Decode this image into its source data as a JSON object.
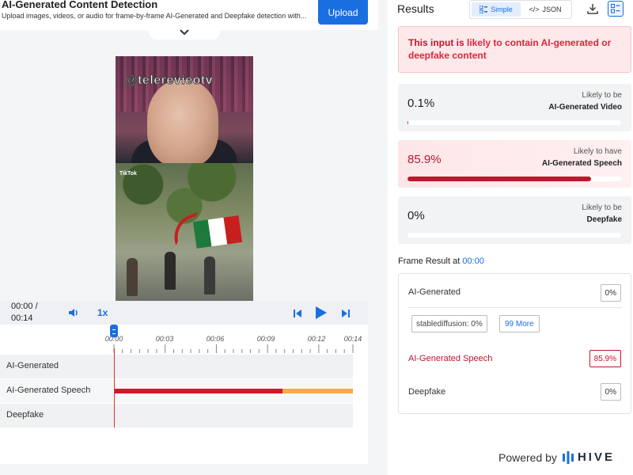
{
  "header": {
    "title": "AI-Generated Content Detection",
    "subtitle": "Upload images, videos, or audio for frame-by-frame AI-Generated and Deepfake detection with...",
    "upload_label": "Upload"
  },
  "video": {
    "watermark": "@telerevieotv",
    "tiktok_label": "TikTok"
  },
  "player": {
    "time_current": "00:00 /",
    "time_total": "00:14",
    "speed": "1x",
    "ticks": [
      "00:00",
      "00:03",
      "00:06",
      "00:09",
      "00:12",
      "00:14"
    ],
    "tracks": [
      "AI-Generated",
      "AI-Generated Speech",
      "Deepfake"
    ]
  },
  "results": {
    "title": "Results",
    "view_simple": "Simple",
    "view_json": "JSON",
    "alert_prefix": "This input is ",
    "alert_emph": "likely to contain AI-generated or deepfake content",
    "cards": [
      {
        "value": "0.1%",
        "k1": "Likely to be",
        "k2": "AI-Generated Video",
        "fill": 0.001
      },
      {
        "value": "85.9%",
        "k1": "Likely to have",
        "k2": "AI-Generated Speech",
        "fill": 0.859
      },
      {
        "value": "0%",
        "k1": "Likely to be",
        "k2": "Deepfake",
        "fill": 0
      }
    ],
    "frame_result_label": "Frame Result at ",
    "frame_result_time": "00:00",
    "frame": {
      "ai_generated_label": "AI-Generated",
      "ai_generated_value": "0%",
      "chip_model": "stablediffusion: 0%",
      "chip_more": "99 More",
      "speech_label": "AI-Generated Speech",
      "speech_value": "85.9%",
      "deepfake_label": "Deepfake",
      "deepfake_value": "0%"
    }
  },
  "footer": {
    "powered_by": "Powered by",
    "brand": "HIVE"
  },
  "colors": {
    "accent": "#1a6fe0",
    "danger": "#c0152d",
    "speech_bar_red": "#d3172b",
    "speech_bar_orange": "#f7ab4a"
  }
}
